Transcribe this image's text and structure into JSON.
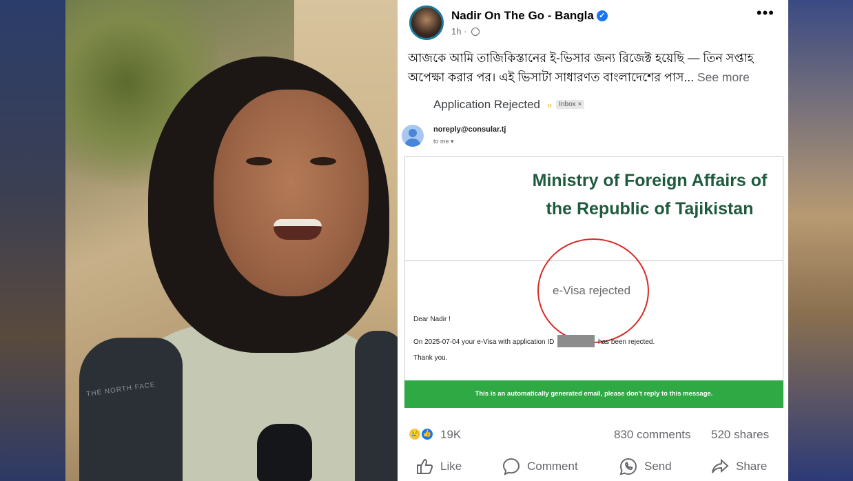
{
  "post": {
    "author": "Nadir On The Go - Bangla",
    "time": "1h",
    "caption": "আজকে আমি তাজিকিস্তানের ই-ভিসার জন্য রিজেক্ট হয়েছি — তিন সপ্তাহ অপেক্ষা করার পর। এই ভিসাটা সাধারণত বাংলাদেশের পাস...",
    "see_more": "See more"
  },
  "email": {
    "subject": "Application Rejected",
    "inbox_tag": "Inbox ×",
    "sender": "noreply@consular.tj",
    "to": "to me",
    "ministry": "Ministry of Foreign Affairs of the Republic of Tajikistan",
    "status": "e-Visa rejected",
    "greeting": "Dear Nadir !",
    "body_before": "On 2025-07-04 your e-Visa with application ID",
    "body_after": "has been rejected.",
    "thanks": "Thank you.",
    "footer_notice": "This is an automatically generated email, please don't reply to this message."
  },
  "stats": {
    "reactions": "19K",
    "comments": "830 comments",
    "shares": "520 shares"
  },
  "actions": {
    "like": "Like",
    "comment": "Comment",
    "send": "Send",
    "share": "Share"
  },
  "colors": {
    "facebook_blue": "#1877f2",
    "ministry_green": "#1f5a3e",
    "footer_green": "#2fa943",
    "circle_red": "#d62b25"
  },
  "icons": [
    "verified-badge-icon",
    "globe-icon",
    "more-options-icon",
    "label-arrow-icon",
    "sad-reaction-icon",
    "like-reaction-icon",
    "like-icon",
    "comment-icon",
    "send-icon",
    "share-icon"
  ],
  "photo": {
    "backpack_brand": "THE NORTH FACE"
  }
}
